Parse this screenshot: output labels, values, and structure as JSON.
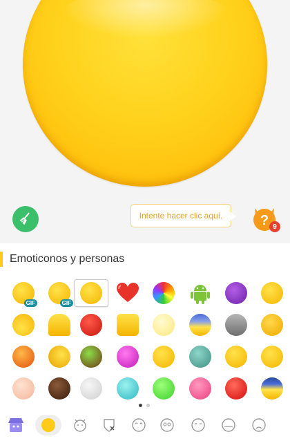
{
  "hint": {
    "text": "Intente hacer clic aquí."
  },
  "help": {
    "badge_count": "9"
  },
  "section": {
    "title": "Emoticonos y personas"
  },
  "gif_label": "GIF",
  "emojis": [
    [
      "gif-yellow",
      "gif-yellow-hand",
      "yellow-plain",
      "red-heart",
      "rainbow-swirl",
      "android-robot",
      "purple-devil",
      "angel-halo"
    ],
    [
      "hair-swirl",
      "ghost-yellow",
      "red-devil",
      "square-yellow",
      "pale-yellow",
      "blue-top",
      "gray-ghost",
      "cat-face"
    ],
    [
      "orange-round",
      "red-eyed",
      "green-mixed",
      "magenta",
      "sun-flower",
      "teal-zombie",
      "flying-yellow",
      "blush"
    ],
    [
      "skin-peach",
      "brown-dark",
      "light-gray",
      "cyan",
      "green-bright",
      "pink",
      "red-bright",
      "navy-yellow"
    ]
  ],
  "pager": {
    "pages": 2,
    "active": 0
  },
  "categories": [
    "shop-icon",
    "smiley-circle-icon",
    "devil-outline-icon",
    "shield-x-icon",
    "smile-eyes-icon",
    "wide-eyes-icon",
    "closed-eyes-icon",
    "flat-face-icon",
    "sad-face-icon"
  ],
  "colors": {
    "accent": "#ffcb18",
    "broom_bg": "#3cbf6a",
    "hint_text": "#e0a323",
    "badge": "#e84030"
  }
}
